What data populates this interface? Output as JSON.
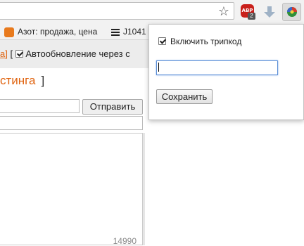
{
  "browser": {
    "bookmarks": [
      {
        "label": "Азот: продажа, цена"
      },
      {
        "label": "J1041"
      }
    ],
    "extensions": {
      "adblock_label": "ABP",
      "adblock_badge": "2"
    }
  },
  "page": {
    "link_fragment": "а",
    "bracket_close": "]",
    "bracket_open": "[",
    "autoupdate_label": "Автообновление через",
    "autoupdate_suffix": "с",
    "listing_heading": "стинга",
    "listing_bracket": "]",
    "send_button": "Отправить",
    "counter": "14990"
  },
  "popup": {
    "tripcode_checkbox_label": "Включить трипкод",
    "tripcode_checked": true,
    "tripcode_input_value": "",
    "save_button": "Сохранить"
  }
}
